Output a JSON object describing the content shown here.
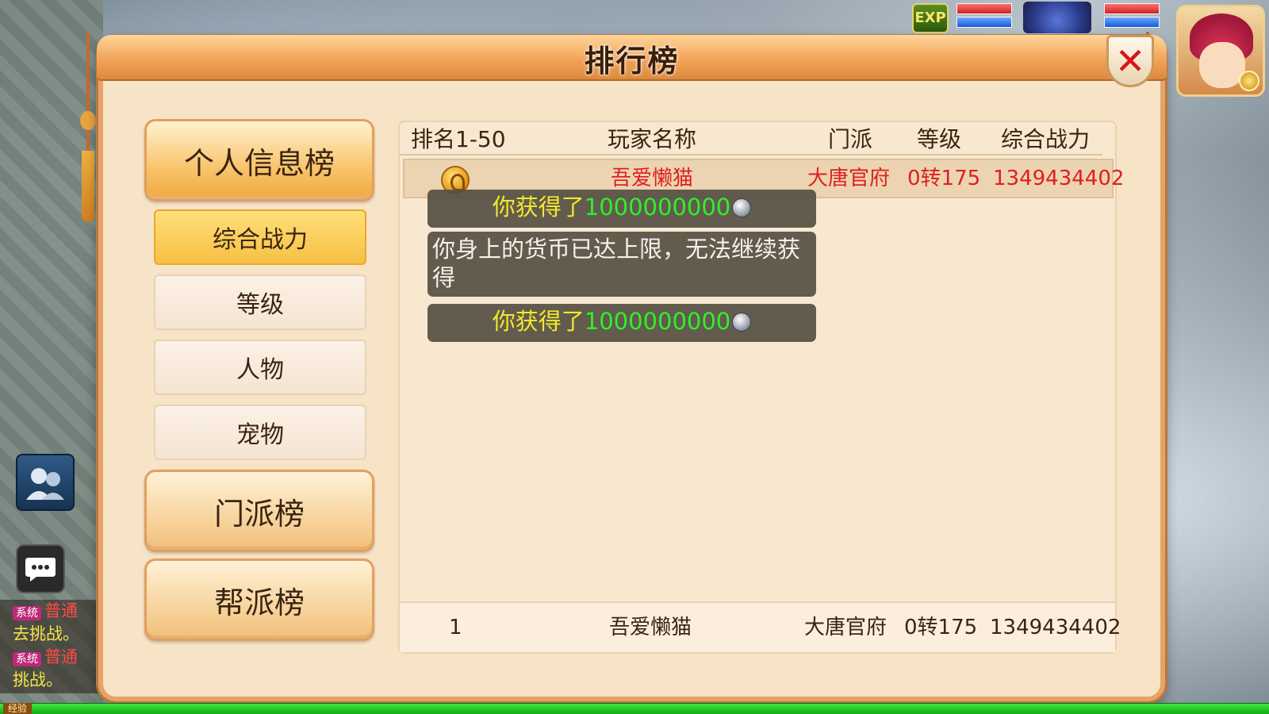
{
  "panel": {
    "title": "排行榜",
    "close_label": "✕"
  },
  "menu": {
    "personal": "个人信息榜",
    "power": "综合战力",
    "level": "等级",
    "character": "人物",
    "pet": "宠物",
    "sect_board": "门派榜",
    "guild_board": "帮派榜"
  },
  "table": {
    "headers": {
      "rank": "排名1-50",
      "name": "玩家名称",
      "sect": "门派",
      "level": "等级",
      "power": "综合战力"
    },
    "rows": [
      {
        "rank": "1",
        "name": "吾爱懒猫",
        "sect": "大唐官府",
        "level": "0转175",
        "power": "1349434402"
      }
    ],
    "self_row": {
      "rank": "1",
      "name": "吾爱懒猫",
      "sect": "大唐官府",
      "level": "0转175",
      "power": "1349434402"
    }
  },
  "toasts": {
    "gain_prefix": "你获得了",
    "gain_amount": "1000000000",
    "limit_msg": "你身上的货币已达上限，无法继续获得"
  },
  "hud": {
    "exp_badge": "EXP"
  },
  "chat": {
    "tag": "系统",
    "line1_suffix": "普通",
    "line2": "去挑战。",
    "line3_suffix": "普通",
    "line4": "挑战。"
  },
  "bottom": {
    "exp_label": "经验"
  },
  "colors": {
    "panel_bg": "#f7e3c6",
    "header_orange": "#f0a054",
    "rank_red": "#e01e1e",
    "toast_green": "#2ef02a",
    "toast_yellow": "#f2e82a"
  }
}
